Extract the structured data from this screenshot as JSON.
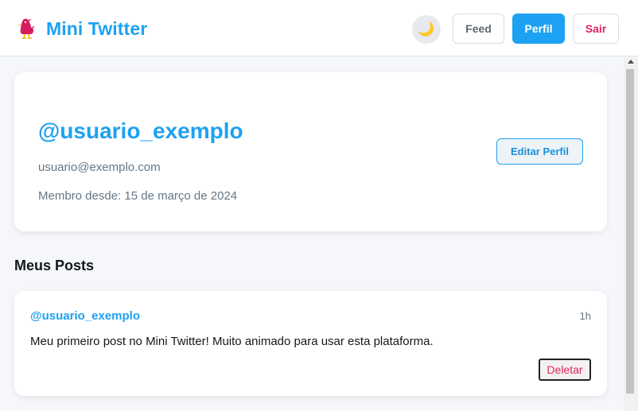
{
  "app": {
    "title": "Mini Twitter",
    "logo_icon": "bird-icon"
  },
  "header": {
    "theme_toggle_icon": "🌙",
    "nav": {
      "feed_label": "Feed",
      "perfil_label": "Perfil",
      "sair_label": "Sair"
    }
  },
  "profile": {
    "username": "@usuario_exemplo",
    "email": "usuario@exemplo.com",
    "member_since": "Membro desde: 15 de março de 2024",
    "edit_label": "Editar Perfil"
  },
  "posts_section": {
    "title": "Meus Posts",
    "posts": [
      {
        "author": "@usuario_exemplo",
        "time": "1h",
        "content": "Meu primeiro post no Mini Twitter! Muito animado para usar esta plataforma.",
        "delete_label": "Deletar"
      }
    ]
  },
  "colors": {
    "accent": "#1da1f2",
    "danger": "#e0245e",
    "background": "#f5f7fa",
    "text_muted": "#657786"
  }
}
